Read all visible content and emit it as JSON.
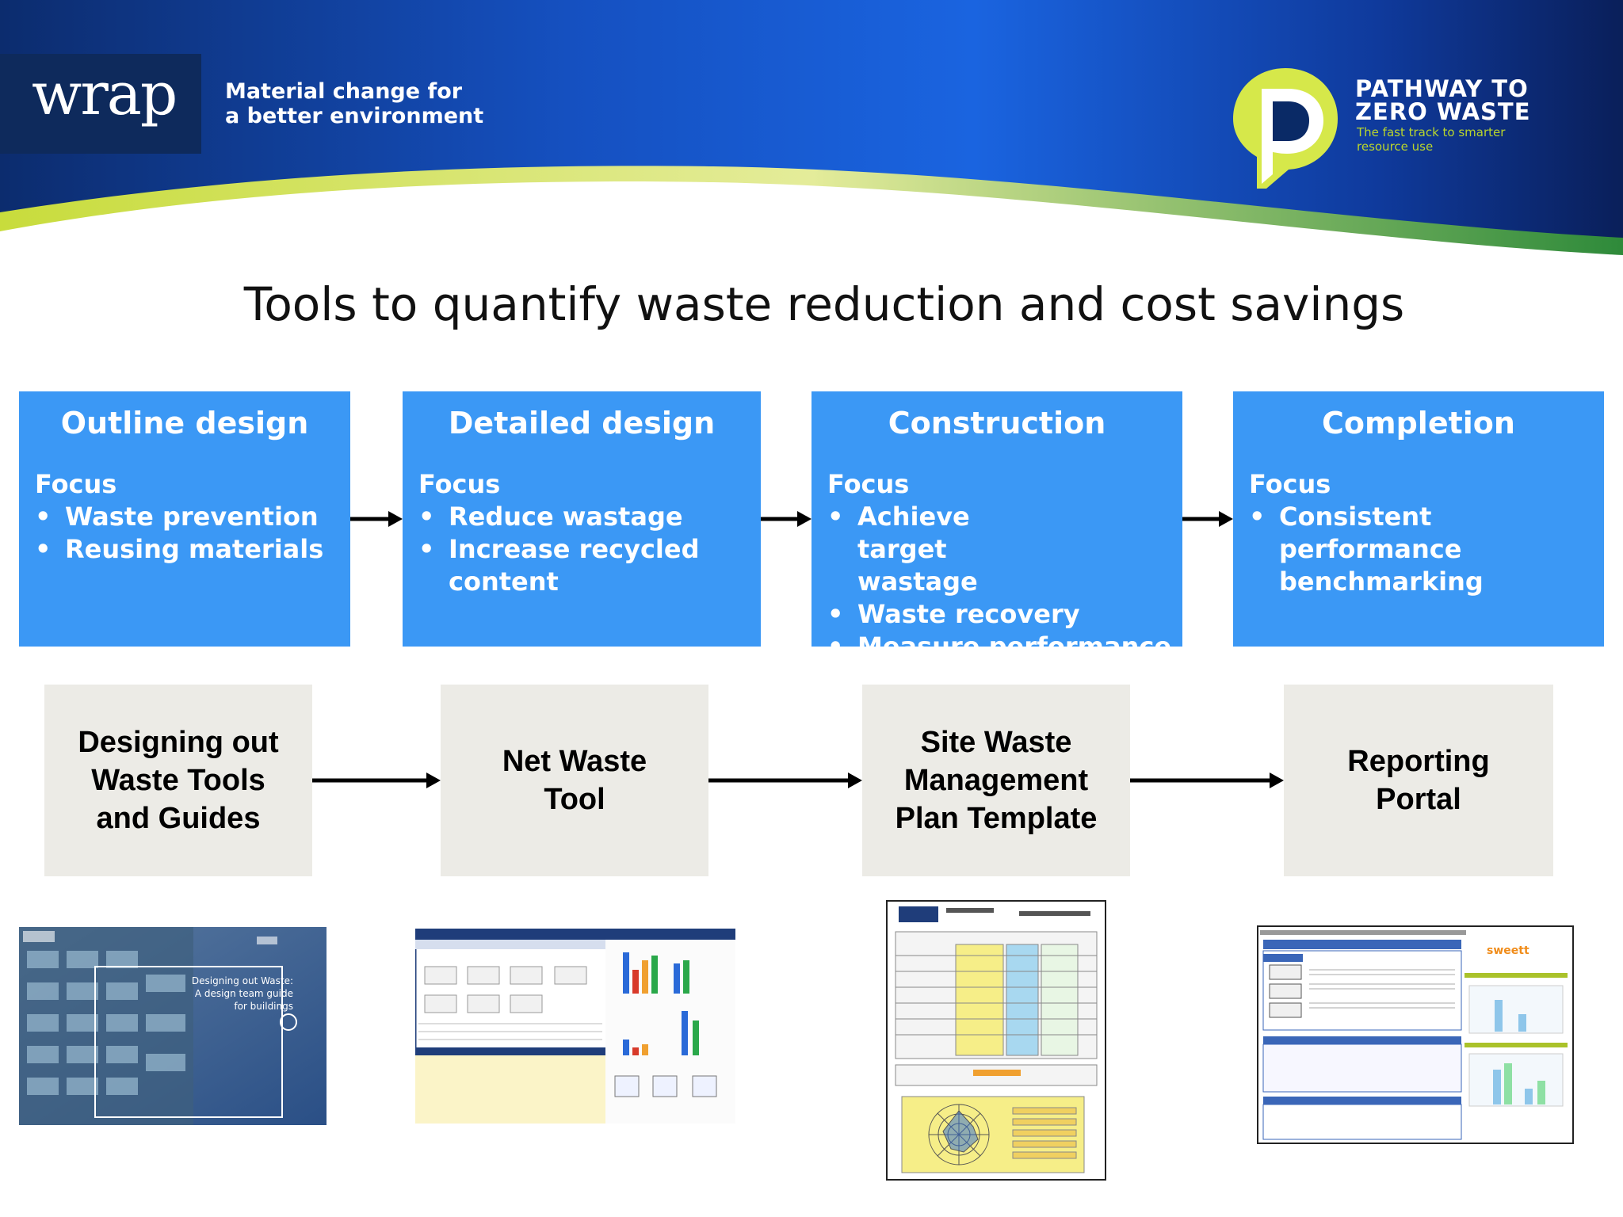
{
  "header": {
    "brand_logo": "wrap",
    "tagline_line1": "Material change for",
    "tagline_line2": "a better environment",
    "pathway_logo_icon": "p-logo-icon",
    "pathway_title_line1": "PATHWAY TO",
    "pathway_title_line2": "ZERO WASTE",
    "pathway_sub_line1": "The fast track to smarter",
    "pathway_sub_line2": "resource use"
  },
  "title": "Tools to quantify waste reduction and cost savings",
  "stages": [
    {
      "title": "Outline design",
      "focus": "Focus",
      "bullets": [
        "Waste prevention",
        "Reusing materials"
      ]
    },
    {
      "title": "Detailed design",
      "focus": "Focus",
      "bullets": [
        "Reduce wastage",
        "Increase recycled content"
      ]
    },
    {
      "title": "Construction",
      "focus": "Focus",
      "bullets": [
        "Achieve target wastage",
        "Waste recovery",
        "Measure performance"
      ]
    },
    {
      "title": "Completion",
      "focus": "Focus",
      "bullets": [
        "Consistent performance benchmarking"
      ]
    }
  ],
  "tools": [
    {
      "line1": "Designing out",
      "line2": "Waste Tools",
      "line3": "and Guides"
    },
    {
      "line1": "Net Waste",
      "line2": "Tool"
    },
    {
      "line1": "Site Waste",
      "line2": "Management",
      "line3": "Plan Template"
    },
    {
      "line1": "Reporting",
      "line2": "Portal"
    }
  ],
  "thumbnails": {
    "guide_cover_line1": "Designing out Waste:",
    "guide_cover_line2": "A design team guide",
    "guide_cover_line3": "for buildings"
  },
  "colors": {
    "stage_blue": "#3b98f5",
    "tool_grey": "#ecebe6",
    "banner_navy": "#0a2a66",
    "banner_blue": "#1a64e0",
    "accent_green": "#b9d52c"
  }
}
